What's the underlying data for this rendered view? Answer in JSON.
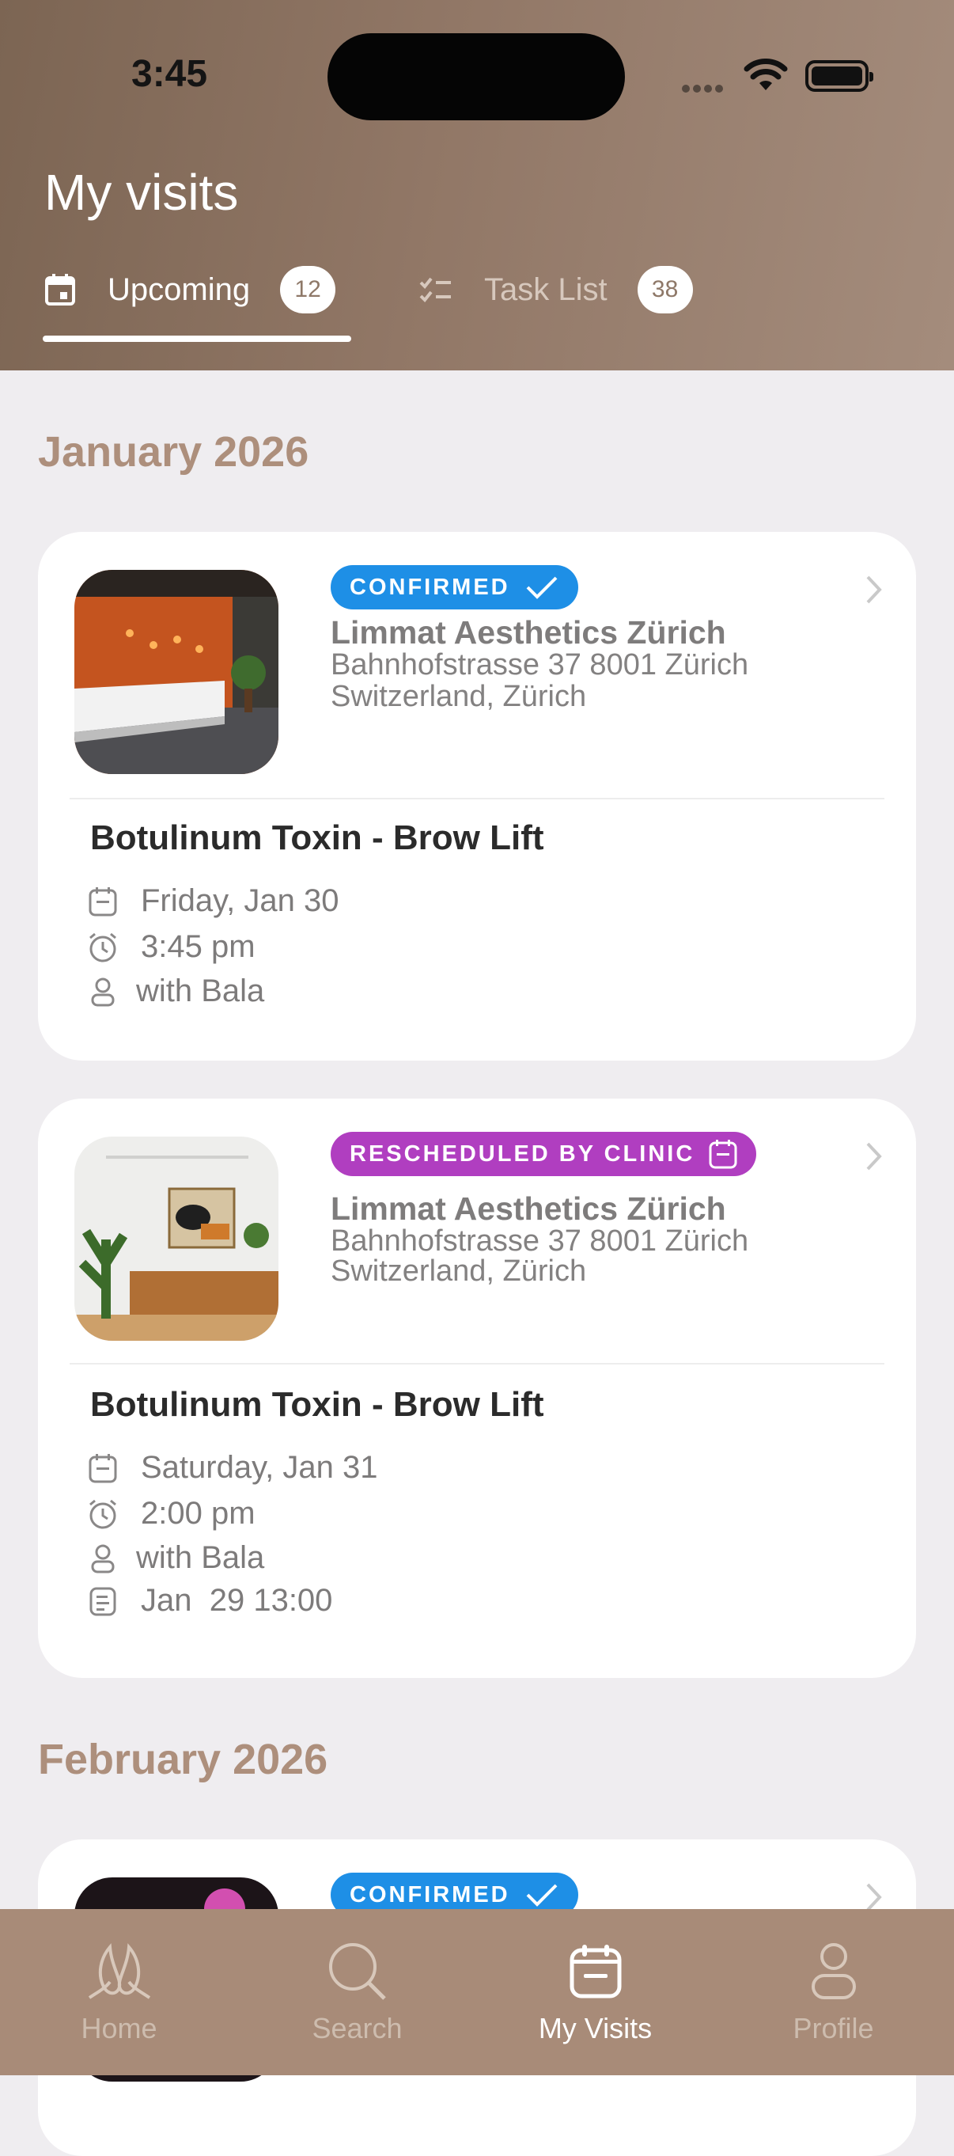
{
  "status_bar": {
    "time": "3:45"
  },
  "header": {
    "title": "My visits",
    "tabs": [
      {
        "label": "Upcoming",
        "count": "12",
        "icon": "calendar-icon",
        "active": true
      },
      {
        "label": "Task List",
        "count": "38",
        "icon": "checklist-icon",
        "active": false
      }
    ]
  },
  "sections": [
    {
      "month": "January 2026",
      "visits": [
        {
          "status": "CONFIRMED",
          "status_color": "#1e8fe6",
          "clinic": "Limmat Aesthetics Zürich",
          "address_line1": "Bahnhofstrasse 37 8001 Zürich",
          "address_line2": "Switzerland, Zürich",
          "treatment": "Botulinum Toxin - Brow Lift",
          "date": "Friday, Jan 30",
          "time": "3:45 pm",
          "with": "with Bala"
        },
        {
          "status": "RESCHEDULED BY CLINIC",
          "status_color": "#b03ec0",
          "clinic": "Limmat Aesthetics Zürich",
          "address_line1": "Bahnhofstrasse 37 8001 Zürich",
          "address_line2": "Switzerland, Zürich",
          "treatment": "Botulinum Toxin - Brow Lift",
          "date": "Saturday, Jan 31",
          "time": "2:00 pm",
          "with": "with Bala",
          "rescheduled_at": "Jan  29 13:00"
        }
      ]
    },
    {
      "month": "February 2026",
      "visits": [
        {
          "status": "CONFIRMED",
          "status_color": "#1e8fe6"
        }
      ]
    }
  ],
  "bottom_nav": [
    {
      "label": "Home",
      "icon": "home-logo-icon",
      "active": false
    },
    {
      "label": "Search",
      "icon": "search-icon",
      "active": false
    },
    {
      "label": "My Visits",
      "icon": "calendar-icon",
      "active": true
    },
    {
      "label": "Profile",
      "icon": "person-icon",
      "active": false
    }
  ]
}
